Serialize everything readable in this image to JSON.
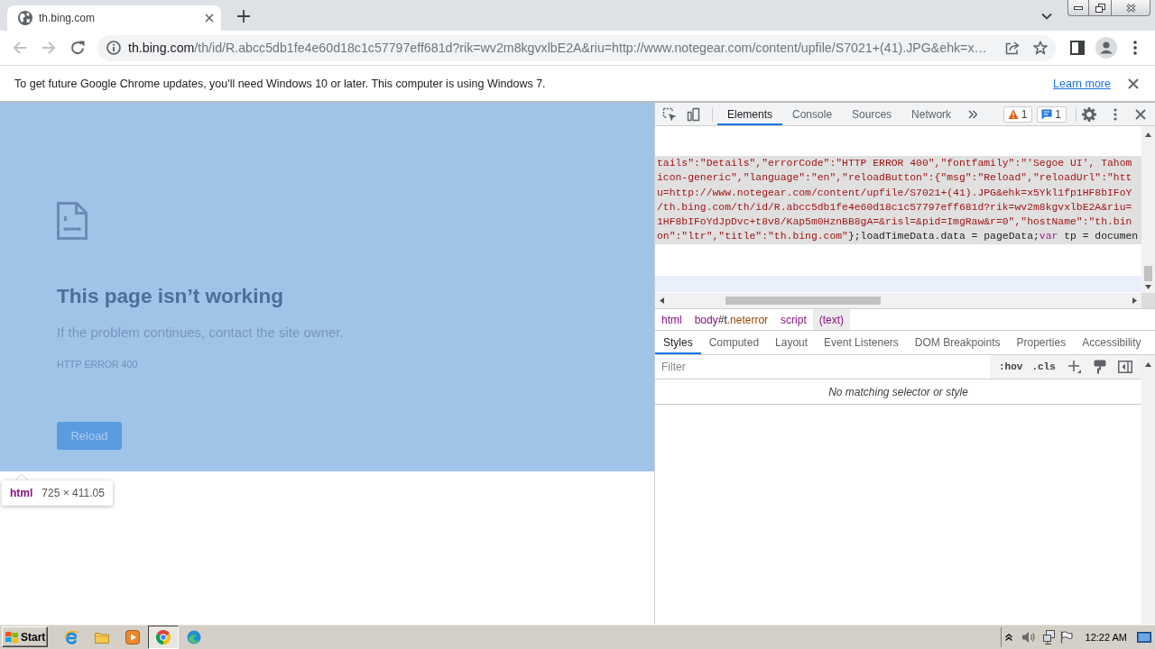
{
  "browser": {
    "tabs": [
      {
        "title": "th.bing.com",
        "selected": true
      }
    ],
    "address_bar": {
      "host": "th.bing.com",
      "path": "/th/id/R.abcc5db1fe4e60d18c1c57797eff681d?rik=wv2m8kgvxlbE2A&riu=http://www.notegear.com/content/upfile/S7021+(41).JPG&ehk=x…"
    }
  },
  "infobar": {
    "message": "To get future Google Chrome updates, you'll need Windows 10 or later. This computer is using Windows 7.",
    "link": "Learn more"
  },
  "page": {
    "heading": "This page isn’t working",
    "message": "If the problem continues, contact the site owner.",
    "error_code": "HTTP ERROR 400",
    "button": "Reload"
  },
  "inspect_tooltip": {
    "tag": "html",
    "size": "725 × 411.05"
  },
  "devtools": {
    "tabs": [
      {
        "label": "Elements",
        "selected": true
      },
      {
        "label": "Console",
        "selected": false
      },
      {
        "label": "Sources",
        "selected": false
      },
      {
        "label": "Network",
        "selected": false
      }
    ],
    "issue_badges": [
      {
        "kind": "warning",
        "count": "1"
      },
      {
        "kind": "message",
        "count": "1"
      }
    ],
    "code_block": {
      "selected": true,
      "lines": [
        {
          "segments": [
            {
              "kind": "string",
              "text": "tails\":\"Details\",\"errorCode\":\"HTTP ERROR 400\",\"fontfamily\":\"'Segoe UI', Tahom"
            }
          ]
        },
        {
          "segments": [
            {
              "kind": "string",
              "text": "icon-generic\",\"language\":\"en\",\"reloadButton\":{\"msg\":\"Reload\",\"reloadUrl\":\"htt"
            }
          ]
        },
        {
          "segments": [
            {
              "kind": "string",
              "text": "u=http://www.notegear.com/content/upfile/S7021+(41).JPG&ehk=x5Ykl1fp1HF8bIFoY"
            }
          ]
        },
        {
          "segments": [
            {
              "kind": "string",
              "text": "/th.bing.com/th/id/R.abcc5db1fe4e60d18c1c57797eff681d?rik=wv2m8kgvxlbE2A&riu="
            }
          ]
        },
        {
          "segments": [
            {
              "kind": "string",
              "text": "1HF8bIFoYdJpDvc+t8v8/Kap5m0HznBB8gA=&risl=&pid=ImgRaw&r=0\",\"hostName\":\"th.bin"
            }
          ]
        },
        {
          "segments": [
            {
              "kind": "string",
              "text": "on\":\"ltr\",\"title\":\"th.bing.com\""
            },
            {
              "kind": "plain",
              "text": "};loadTimeData.data = pageData;"
            },
            {
              "kind": "keyword",
              "text": "var"
            },
            {
              "kind": "plain",
              "text": " tp = documen"
            }
          ]
        }
      ]
    },
    "breadcrumbs": [
      {
        "selected": false,
        "parts": [
          {
            "kind": "tag",
            "text": "html"
          }
        ]
      },
      {
        "selected": false,
        "parts": [
          {
            "kind": "tag",
            "text": "body"
          },
          {
            "kind": "id",
            "text": "#t"
          },
          {
            "kind": "class",
            "text": ".neterror"
          }
        ]
      },
      {
        "selected": false,
        "parts": [
          {
            "kind": "tag",
            "text": "script"
          }
        ]
      },
      {
        "selected": true,
        "parts": [
          {
            "kind": "text",
            "text": "(text)"
          }
        ]
      }
    ],
    "pane_tabs": [
      {
        "label": "Styles",
        "selected": true
      },
      {
        "label": "Computed",
        "selected": false
      },
      {
        "label": "Layout",
        "selected": false
      },
      {
        "label": "Event Listeners",
        "selected": false
      },
      {
        "label": "DOM Breakpoints",
        "selected": false
      },
      {
        "label": "Properties",
        "selected": false
      },
      {
        "label": "Accessibility",
        "selected": false
      }
    ],
    "filter": {
      "placeholder": "Filter"
    },
    "filter_buttons": [
      ":hov",
      ".cls"
    ],
    "empty_message": "No matching selector or style"
  },
  "taskbar": {
    "start_label": "Start",
    "apps": [
      {
        "kind": "letter_e",
        "selected": false
      },
      {
        "kind": "folder",
        "selected": false
      },
      {
        "kind": "player",
        "selected": false
      },
      {
        "kind": "ring",
        "selected": true
      },
      {
        "kind": "wave",
        "selected": false
      }
    ],
    "clock": "12:22 AM"
  }
}
